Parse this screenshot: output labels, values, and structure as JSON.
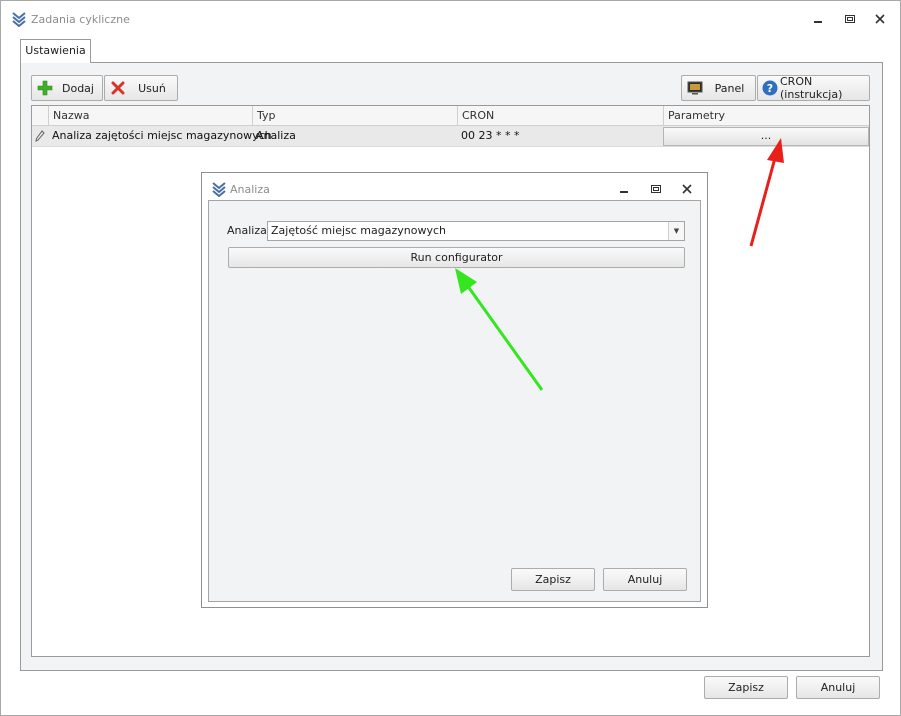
{
  "window": {
    "title": "Zadania cykliczne",
    "controls": [
      "minimize",
      "maximize",
      "close"
    ]
  },
  "tabs": [
    {
      "label": "Ustawienia",
      "active": true
    }
  ],
  "toolbar": {
    "add_label": "Dodaj",
    "delete_label": "Usuń",
    "panel_label": "Panel",
    "cron_help_label": "CRON (instrukcja)"
  },
  "grid": {
    "columns": [
      "Nazwa",
      "Typ",
      "CRON",
      "Parametry"
    ],
    "rows": [
      {
        "name": "Analiza zajętości miejsc magazynowych",
        "type": "Analiza",
        "cron": "00 23 * * *",
        "params_button": "..."
      }
    ]
  },
  "dialog": {
    "title": "Analiza",
    "analysis_label": "Analiza",
    "analysis_value": "Zajętość miejsc magazynowych",
    "run_configurator_label": "Run configurator",
    "save_label": "Zapisz",
    "cancel_label": "Anuluj"
  },
  "footer": {
    "save_label": "Zapisz",
    "cancel_label": "Anuluj"
  },
  "colors": {
    "panel_bg": "#f2f3f5",
    "grid_row_bg": "#e9e9e9",
    "add_icon": "#3fae2a",
    "delete_icon": "#d8342a",
    "help_icon": "#2f6fc0",
    "annotation_red": "#e8201c",
    "annotation_green": "#33e61e"
  },
  "icons": {
    "app": "stacked-chevrons-icon",
    "add": "plus-icon",
    "delete": "x-icon",
    "panel": "monitor-icon",
    "help": "question-icon",
    "row_edit": "pencil-icon"
  }
}
